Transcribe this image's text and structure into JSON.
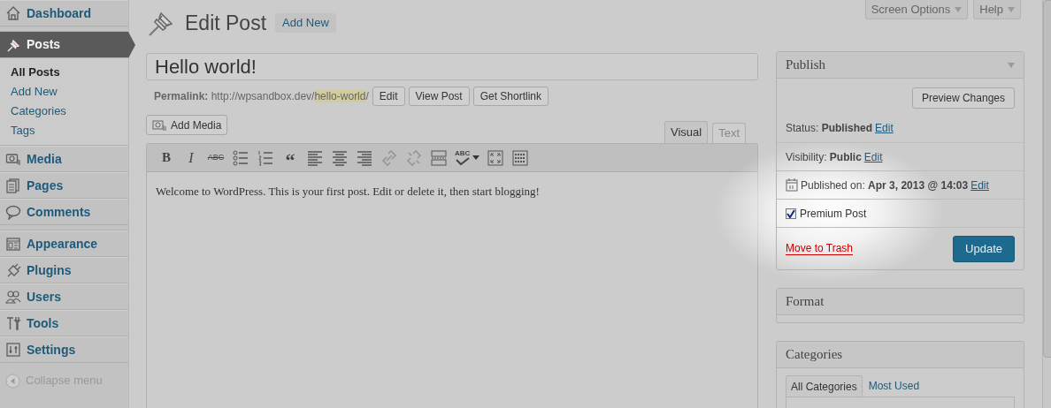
{
  "sidebar": {
    "groups": [
      [
        {
          "label": "Dashboard",
          "selected": false
        }
      ],
      [
        {
          "label": "Posts",
          "selected": true,
          "children": [
            {
              "label": "All Posts",
              "selected": true
            },
            {
              "label": "Add New",
              "selected": false
            },
            {
              "label": "Categories",
              "selected": false
            },
            {
              "label": "Tags",
              "selected": false
            }
          ]
        },
        {
          "label": "Media",
          "selected": false
        },
        {
          "label": "Pages",
          "selected": false
        },
        {
          "label": "Comments",
          "selected": false
        }
      ],
      [
        {
          "label": "Appearance",
          "selected": false
        },
        {
          "label": "Plugins",
          "selected": false
        },
        {
          "label": "Users",
          "selected": false
        },
        {
          "label": "Tools",
          "selected": false
        },
        {
          "label": "Settings",
          "selected": false
        }
      ]
    ],
    "collapse": "Collapse menu"
  },
  "screen_tabs": [
    "Screen Options",
    "Help"
  ],
  "header": {
    "title": "Edit Post",
    "add_new": "Add New"
  },
  "post": {
    "title": "Hello world!",
    "permalink": {
      "label": "Permalink:",
      "base": "http://wpsandbox.dev/",
      "slug": "hello-world",
      "trail": "/"
    },
    "permalink_buttons": [
      "Edit",
      "View Post",
      "Get Shortlink"
    ],
    "add_media": "Add Media",
    "editor_tabs": [
      {
        "label": "Visual",
        "selected": true
      },
      {
        "label": "Text",
        "selected": false
      }
    ],
    "toolbar": [
      {
        "kind": "bold",
        "label": "B"
      },
      {
        "kind": "italic",
        "label": "I"
      },
      {
        "kind": "strike",
        "label": "ABC"
      },
      {
        "kind": "bullets"
      },
      {
        "kind": "numbers"
      },
      {
        "kind": "quote",
        "label": "“"
      },
      {
        "kind": "align-left"
      },
      {
        "kind": "align-center"
      },
      {
        "kind": "align-right"
      },
      {
        "kind": "link",
        "disabled": true
      },
      {
        "kind": "unlink",
        "disabled": true
      },
      {
        "kind": "more"
      },
      {
        "kind": "spell",
        "label": "ABC"
      },
      {
        "kind": "fullscreen"
      },
      {
        "kind": "kitchen"
      }
    ],
    "content": "Welcome to WordPress. This is your first post. Edit or delete it, then start blogging!"
  },
  "publish": {
    "title": "Publish",
    "preview": "Preview Changes",
    "rows": [
      {
        "kind": "status",
        "text": "Status: **Published**",
        "link": "Edit"
      },
      {
        "kind": "visibility",
        "text": "Visibility: **Public**",
        "link": "Edit"
      },
      {
        "kind": "date",
        "text": "Published on: **Apr 3, 2013 @ 14:03**",
        "link": "Edit"
      },
      {
        "kind": "checkbox",
        "text": "Premium Post",
        "checked": true
      }
    ],
    "trash": "Move to Trash",
    "update": "Update"
  },
  "format": {
    "title": "Format"
  },
  "categories": {
    "title": "Categories",
    "tabs": [
      {
        "label": "All Categories",
        "selected": true
      },
      {
        "label": "Most Used",
        "selected": false
      }
    ]
  }
}
